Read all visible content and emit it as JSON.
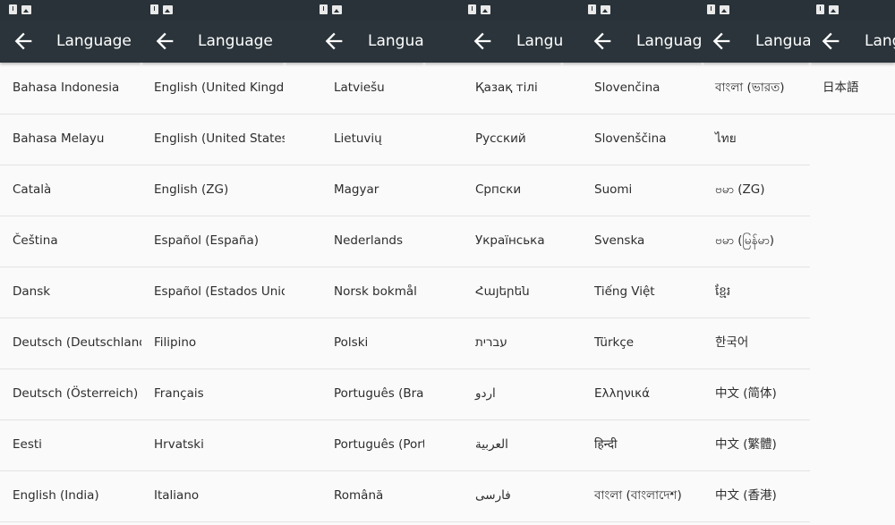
{
  "screen_title": "Language",
  "panels": [
    {
      "title": "Language",
      "items": [
        "Bahasa Indonesia",
        "Bahasa Melayu",
        "Català",
        "Čeština",
        "Dansk",
        "Deutsch (Deutschland)",
        "Deutsch (Österreich)",
        "Eesti",
        "English (India)"
      ]
    },
    {
      "title": "Language",
      "items": [
        "English (United Kingdom)",
        "English (United States)",
        "English (ZG)",
        "Español (España)",
        "Español (Estados Unidos)",
        "Filipino",
        "Français",
        "Hrvatski",
        "Italiano"
      ]
    },
    {
      "title": "Language",
      "items": [
        "Latviešu",
        "Lietuvių",
        "Magyar",
        "Nederlands",
        "Norsk bokmål",
        "Polski",
        "Português (Brasil)",
        "Português (Portugal)",
        "Română"
      ]
    },
    {
      "title": "Language",
      "items": [
        "Қазақ тілі",
        "Русский",
        "Српски",
        "Українська",
        "Հայերեն",
        "עברית",
        "اردو",
        "العربية",
        "فارسی"
      ]
    },
    {
      "title": "Language",
      "items": [
        "Slovenčina",
        "Slovenščina",
        "Suomi",
        "Svenska",
        "Tiếng Việt",
        "Türkçe",
        "Ελληνικά",
        "हिन्दी",
        "বাংলা (বাংলাদেশ)"
      ]
    },
    {
      "title": "Language",
      "items": [
        "বাংলা (ভারত)",
        "ไทย",
        "ဗမာ (ZG)",
        "ဗမာ (မြန်မာ)",
        "ខ្មែរ",
        "한국어",
        "中文 (简体)",
        "中文 (繁體)",
        "中文 (香港)"
      ]
    },
    {
      "title": "Language",
      "items": [
        "日本語"
      ]
    }
  ],
  "icons": {
    "back": "arrow-back-icon",
    "notification": "alert-notification-icon",
    "image": "image-notification-icon"
  },
  "colors": {
    "toolbar": "#2a343a",
    "statusbar": "#283238",
    "background": "#fafafa",
    "text": "#2d2d2d"
  }
}
